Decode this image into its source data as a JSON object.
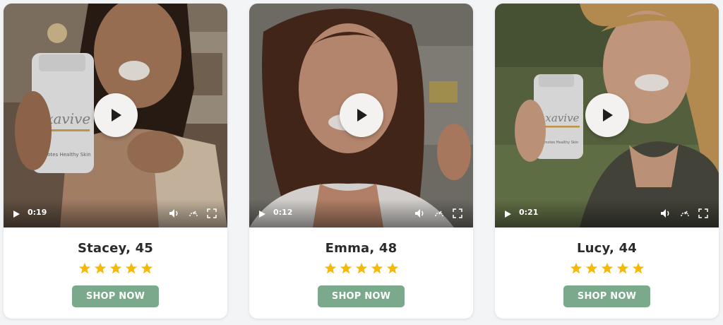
{
  "colors": {
    "page_bg": "#f3f4f6",
    "button_bg": "#7aa98c",
    "star": "#f5b90a",
    "play_button": "#f4f2f0"
  },
  "testimonials": [
    {
      "name": "Stacey, 45",
      "rating": 5,
      "video_time": "0:19",
      "button_label": "SHOP NOW",
      "bottle_brand": "Axavive",
      "bottle_tagline": "Promotes Healthy Skin"
    },
    {
      "name": "Emma, 48",
      "rating": 5,
      "video_time": "0:12",
      "button_label": "SHOP NOW"
    },
    {
      "name": "Lucy, 44",
      "rating": 5,
      "video_time": "0:21",
      "button_label": "SHOP NOW",
      "bottle_brand": "Axavive",
      "bottle_tagline": "Promotes Healthy Skin"
    }
  ],
  "icons": {
    "play": "play-icon",
    "volume": "volume-icon",
    "speed": "playback-speed-icon",
    "fullscreen": "fullscreen-icon",
    "star": "star-icon"
  }
}
